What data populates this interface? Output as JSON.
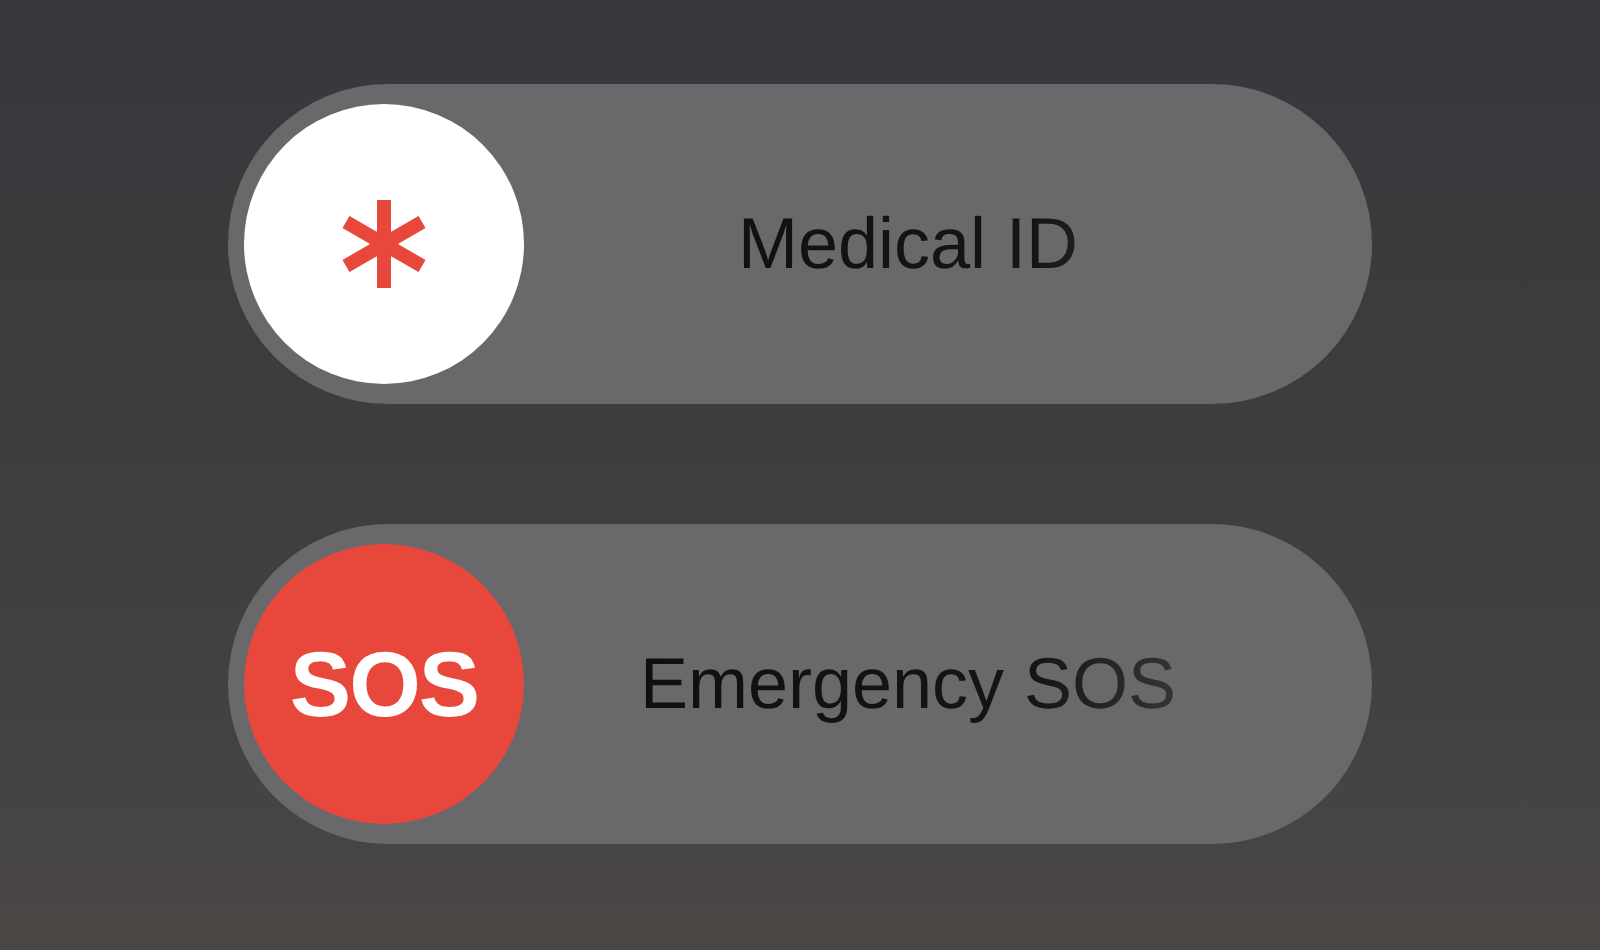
{
  "sliders": [
    {
      "kind": "medical",
      "label": "Medical ID"
    },
    {
      "kind": "sos",
      "label": "Emergency SOS",
      "knob_text": "SOS"
    }
  ]
}
